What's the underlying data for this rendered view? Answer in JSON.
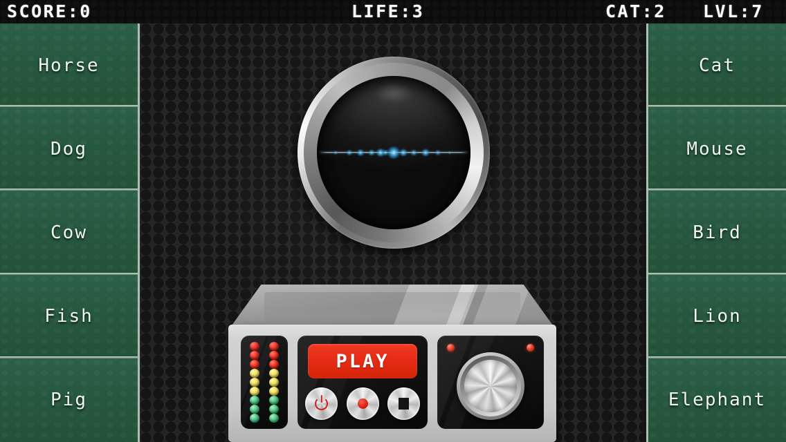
{
  "statusbar": {
    "score": "SCORE:0",
    "life": "LIFE:3",
    "cat": "CAT:2",
    "lvl": "LVL:7"
  },
  "sidebar_left": {
    "items": [
      {
        "label": "Horse"
      },
      {
        "label": "Dog"
      },
      {
        "label": "Cow"
      },
      {
        "label": "Fish"
      },
      {
        "label": "Pig"
      }
    ]
  },
  "sidebar_right": {
    "items": [
      {
        "label": "Cat"
      },
      {
        "label": "Mouse"
      },
      {
        "label": "Bird"
      },
      {
        "label": "Lion"
      },
      {
        "label": "Elephant"
      }
    ]
  },
  "scope": {
    "waveform": {
      "blobs": [
        {
          "x": 12.0,
          "size": 7,
          "opacity": 0.45
        },
        {
          "x": 21.0,
          "size": 9,
          "opacity": 0.7
        },
        {
          "x": 28.5,
          "size": 11,
          "opacity": 0.8
        },
        {
          "x": 35.5,
          "size": 10,
          "opacity": 0.72
        },
        {
          "x": 41.5,
          "size": 13,
          "opacity": 0.9
        },
        {
          "x": 44.5,
          "size": 10,
          "opacity": 0.62
        },
        {
          "x": 50.0,
          "size": 19,
          "opacity": 1.0
        },
        {
          "x": 56.5,
          "size": 12,
          "opacity": 0.82
        },
        {
          "x": 63.0,
          "size": 10,
          "opacity": 0.7
        },
        {
          "x": 70.5,
          "size": 12,
          "opacity": 0.84
        },
        {
          "x": 79.0,
          "size": 9,
          "opacity": 0.58
        },
        {
          "x": 86.5,
          "size": 6,
          "opacity": 0.35
        }
      ]
    }
  },
  "console": {
    "led_meter": {
      "columns": 2,
      "colors": [
        "red",
        "red",
        "red",
        "yellow",
        "yellow",
        "yellow",
        "green",
        "green",
        "green"
      ]
    },
    "display": {
      "text": "PLAY",
      "bg_color": "#e42c16",
      "text_color": "#ffffff"
    },
    "buttons": [
      {
        "name": "power",
        "icon": "power-icon",
        "accent": "#cc2020"
      },
      {
        "name": "record",
        "icon": "record-icon",
        "accent": "#d01a0c"
      },
      {
        "name": "stop",
        "icon": "stop-icon",
        "accent": "#141414"
      }
    ],
    "knob": {
      "label": "volume-knob",
      "indicator_lights": 2,
      "light_color": "#e8402c"
    }
  },
  "theme": {
    "sidebar_green": "#27593f",
    "accent_red": "#e42c16",
    "bezel_silver": "#d2d2d2",
    "status_text": "#fdfdfd"
  }
}
